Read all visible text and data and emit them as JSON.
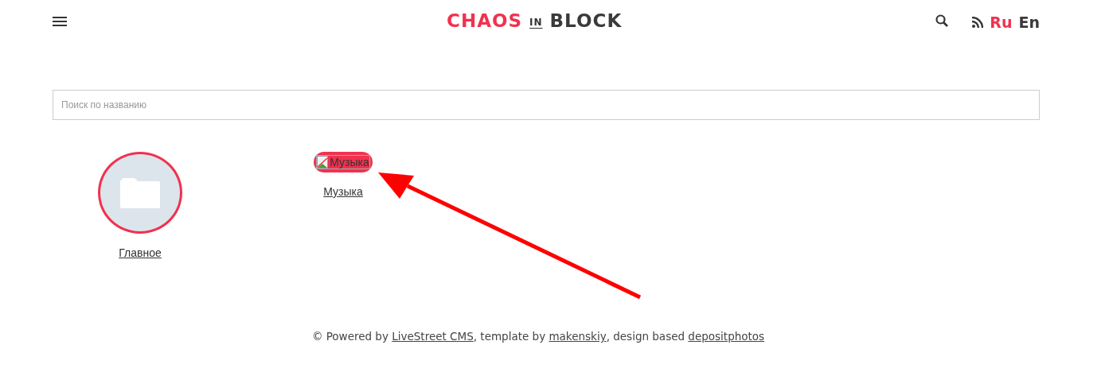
{
  "header": {
    "logo": {
      "part_1": "CHAOS",
      "part_2": "IN",
      "part_3": "BLOCK"
    },
    "languages": [
      {
        "label": "Ru",
        "selected": true
      },
      {
        "label": "En",
        "selected": false
      }
    ]
  },
  "search": {
    "placeholder": "Поиск по названию"
  },
  "categories": [
    {
      "kind": "folder",
      "label": "Главное"
    },
    {
      "kind": "broken-image",
      "alt": "Музыка",
      "label": "Музыка"
    }
  ],
  "footer": [
    {
      "kind": "text",
      "text": "© Powered by "
    },
    {
      "kind": "link",
      "text": "LiveStreet CMS"
    },
    {
      "kind": "text",
      "text": ", template by "
    },
    {
      "kind": "link",
      "text": "makenskiy"
    },
    {
      "kind": "text",
      "text": ", design based "
    },
    {
      "kind": "link",
      "text": "depositphotos"
    }
  ]
}
